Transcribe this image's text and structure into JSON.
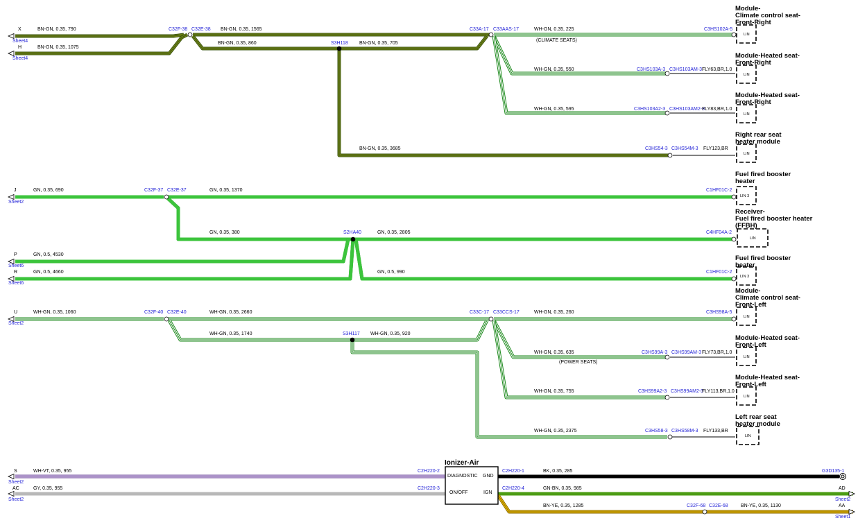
{
  "colors": {
    "BN-GN": [
      "#3a5410",
      "#7a8a18",
      "#3a5410"
    ],
    "GN": [
      "#1e8a1e",
      "#3cc43c",
      "#1e8a1e"
    ],
    "WH-GN": [
      "#1e8a1e",
      "#ffffff",
      "#1e8a1e"
    ],
    "GN-BN": [
      "#3a7010",
      "#4c9c14",
      "#3a7010"
    ],
    "WH-VT": [
      "#7a5aa0",
      "#dccbf0",
      "#7a5aa0"
    ],
    "GY": [
      "#9a9a9a",
      "#b8b8b8",
      "#9a9a9a"
    ],
    "BK": [
      "#000000",
      "#000000",
      "#000000"
    ],
    "BN-YE": [
      "#8a6a00",
      "#f0c000",
      "#8a6a00"
    ],
    "connector_text": "#1f1fd6"
  },
  "offsheet": [
    {
      "letter": "X",
      "sheet": "Sheet4"
    },
    {
      "letter": "H",
      "sheet": "Sheet4"
    },
    {
      "letter": "J",
      "sheet": "Sheet2"
    },
    {
      "letter": "P",
      "sheet": "Sheet6"
    },
    {
      "letter": "R",
      "sheet": "Sheet6"
    },
    {
      "letter": "U",
      "sheet": "Sheet2"
    },
    {
      "letter": "S",
      "sheet": "Sheet2"
    },
    {
      "letter": "AC",
      "sheet": "Sheet2"
    },
    {
      "letter": "AD",
      "sheet": "Sheet2"
    },
    {
      "letter": "AA",
      "sheet": "Sheet1"
    }
  ],
  "wire_labels": [
    "BN-GN, 0.35, 790",
    "BN-GN, 0.35, 1075",
    "BN-GN, 0.35, 1565",
    "BN-GN, 0.35, 860",
    "BN-GN, 0.35, 705",
    "WH-GN, 0.35, 225",
    "WH-GN, 0.35, 550",
    "WH-GN, 0.35, 595",
    "BN-GN, 0.35, 3685",
    "GN, 0.35, 690",
    "GN, 0.35, 1370",
    "GN, 0.35, 380",
    "GN, 0.35, 2805",
    "GN, 0.5, 4530",
    "GN, 0.5, 4660",
    "GN, 0.5, 990",
    "WH-GN, 0.35, 1060",
    "WH-GN, 0.35, 2660",
    "WH-GN, 0.35, 260",
    "WH-GN, 0.35, 1740",
    "WH-GN, 0.35, 920",
    "WH-GN, 0.35, 635",
    "WH-GN, 0.35, 755",
    "WH-GN, 0.35, 2375",
    "WH-VT, 0.35, 955",
    "GY, 0.35, 955",
    "BK, 0.35, 285",
    "GN-BN, 0.35, 985",
    "BN-YE, 0.35, 1285",
    "BN-YE, 0.35, 1130"
  ],
  "connectors": [
    "C32F-38",
    "C32E-38",
    "S3H118",
    "C33A-17",
    "C33AAS-17",
    "C3HS102A-5",
    "C3HS103A-3",
    "C3HS103AM-3",
    "C3HS103A2-3",
    "C3HS103AM2-3",
    "C3HS54-3",
    "C3HS54M-3",
    "C32F-37",
    "C32E-37",
    "C1HF01C-2",
    "S2HA40",
    "C4HF04A-2",
    "C1HF01C-2",
    "C32F-40",
    "C32E-40",
    "C33C-17",
    "C33CCS-17",
    "C3HS98A-5",
    "S3H117",
    "C3HS99A-3",
    "C3HS99AM-3",
    "C3HS99A2-3",
    "C3HS99AM2-3",
    "C3HS58-3",
    "C3HS58M-3",
    "C2H220-2",
    "C2H220-3",
    "C2H220-1",
    "C2H220-4",
    "G3D135-1",
    "C32F-68",
    "C32E-68"
  ],
  "notes": [
    "(CLIMATE SEATS)",
    "(POWER SEATS)"
  ],
  "fly_labels": [
    "FLY63,BR,1.0",
    "FLY83,BR,1.0",
    "FLY123,BR",
    "FLY73,BR,1.0",
    "FLY113,BR,1.0",
    "FLY133,BR"
  ],
  "modules": [
    {
      "lines": [
        "Module-",
        "Climate control seat-",
        "Front-Right"
      ],
      "box": "LIN"
    },
    {
      "lines": [
        "Module-Heated seat-",
        "Front-Right"
      ],
      "box": "LIN"
    },
    {
      "lines": [
        "Module-Heated seat-",
        "Front-Right"
      ],
      "box": "LIN"
    },
    {
      "lines": [
        "Right rear seat",
        "heater module"
      ],
      "box": "LIN"
    },
    {
      "lines": [
        "Fuel fired booster",
        "heater"
      ],
      "box": "LIN 3"
    },
    {
      "lines": [
        "Receiver-",
        "Fuel fired booster heater",
        "(FFBH)"
      ],
      "box": "LIN"
    },
    {
      "lines": [
        "Fuel fired booster",
        "heater"
      ],
      "box": "LIN 3"
    },
    {
      "lines": [
        "Module-",
        "Climate control seat-",
        "Front-Left"
      ],
      "box": "LIN"
    },
    {
      "lines": [
        "Module-Heated seat-",
        "Front-Left"
      ],
      "box": "LIN"
    },
    {
      "lines": [
        "Module-Heated seat-",
        "Front-Left"
      ],
      "box": "LIN"
    },
    {
      "lines": [
        "Left rear seat",
        "heater module"
      ],
      "box": "LIN"
    }
  ],
  "ionizer": {
    "title": "Ionizer-Air",
    "diagnostic": "DIAGNOSTIC",
    "gnd": "GND",
    "onoff": "ON/OFF",
    "ign": "IGN"
  }
}
